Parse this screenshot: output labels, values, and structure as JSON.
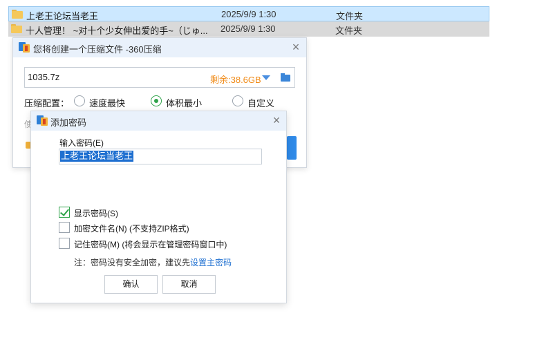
{
  "explorer": {
    "rows": [
      {
        "name": "上老王论坛当老王",
        "date": "2025/9/9 1:30",
        "type": "文件夹"
      },
      {
        "name": "十人管理！ ~对十个少女伸出爱的手~（じゅ...",
        "date": "2025/9/9 1:30",
        "type": "文件夹"
      }
    ]
  },
  "compress_dialog": {
    "title": "您将创建一个压缩文件 -360压缩",
    "filename": "1035.7z",
    "free_space": "剩余:38.6GB",
    "config_label": "压缩配置：",
    "options": [
      "速度最快",
      "体积最小",
      "自定义"
    ],
    "selected_option": "体积最小",
    "obscured_text": "使",
    "colors": {
      "accent": "#2f8ae8",
      "free_space": "#f08a16",
      "selected": "#2fa34a"
    }
  },
  "password_dialog": {
    "title": "添加密码",
    "input_label": "输入密码(E)",
    "password_value": "上老王论坛当老王",
    "checkboxes": [
      {
        "label": "显示密码(S)",
        "checked": true
      },
      {
        "label": "加密文件名(N) (不支持ZIP格式)",
        "checked": false
      },
      {
        "label": "记住密码(M) (将会显示在管理密码窗口中)",
        "checked": false
      }
    ],
    "note_prefix": "注：密码没有安全加密，建议先",
    "note_link": "设置主密码",
    "ok_label": "确认",
    "cancel_label": "取消"
  }
}
